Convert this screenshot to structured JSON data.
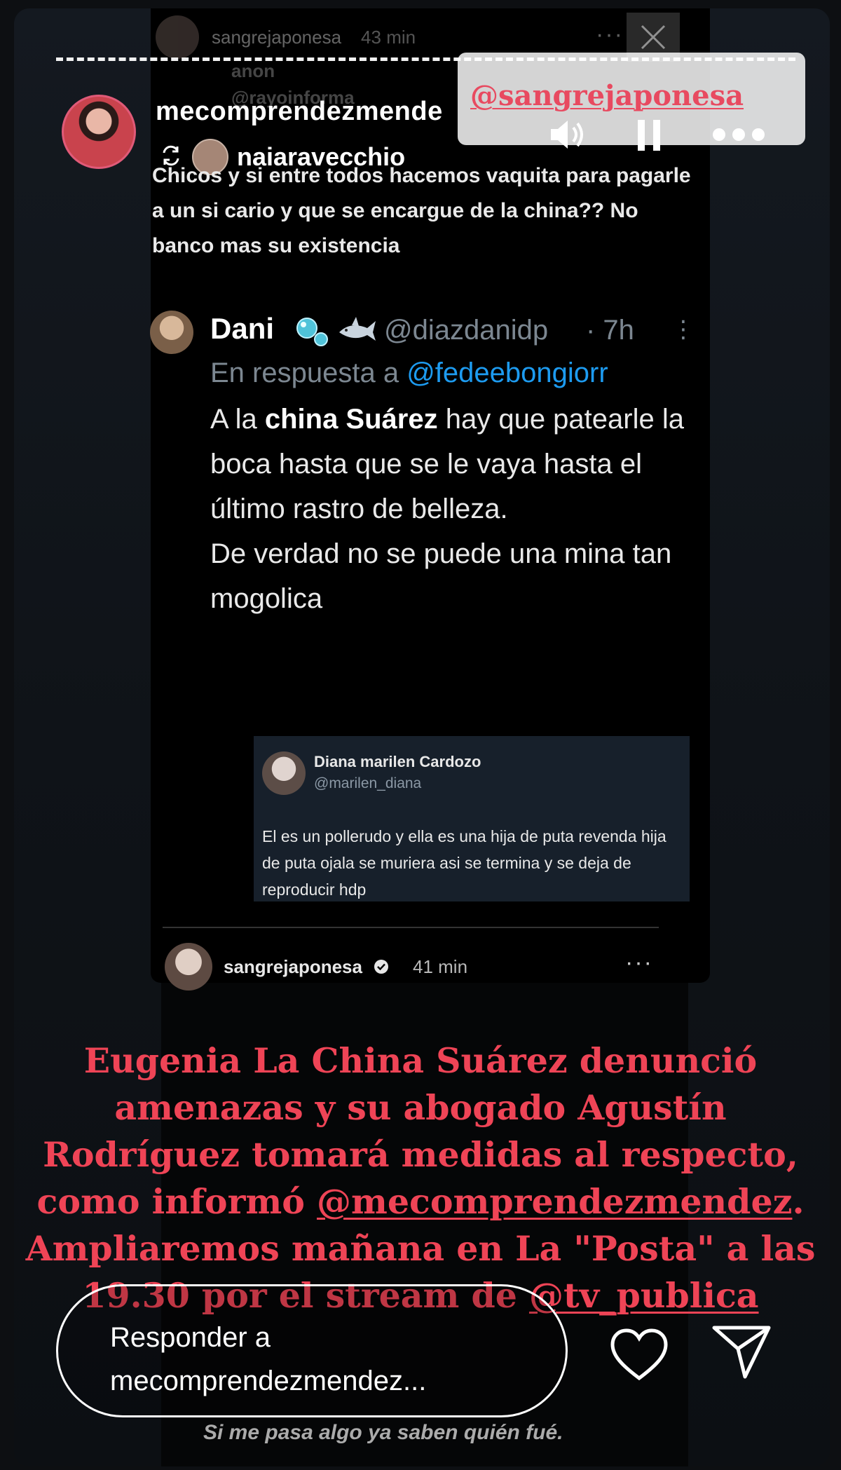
{
  "inner_header": {
    "username": "sangrejaponesa",
    "time": "43 min",
    "more_glyph": "···",
    "background_labels": [
      "anon",
      "@rayoinforma"
    ]
  },
  "story": {
    "username": "mecomprendezmende",
    "reposted_from": "naiaravecchio"
  },
  "sticker": {
    "mention": "@sangrejaponesa",
    "more_glyph": "•••"
  },
  "caption_post": {
    "text": "Chicos y si entre todos hacemos vaquita para pagarle a un si cario y que se encargue de la china?? No banco mas su existencia"
  },
  "tweet": {
    "name": "Dani",
    "handle": "@diazdanidp",
    "time": "· 7h",
    "more": "⋮",
    "reply_prefix": "En respuesta a",
    "reply_mention": "@fedeebongiorr",
    "text_before_bold": "A la ",
    "text_bold": "china Suárez",
    "text_after_bold": " hay que patearle la boca hasta que se le vaya hasta el último rastro de belleza.",
    "text_line2": "De verdad no se puede una mina tan mogolica"
  },
  "quoted": {
    "name": "Diana marilen Cardozo",
    "handle": "@marilen_diana",
    "text": "El es un pollerudo y ella es una hija de puta revenda hija de puta ojala se muriera asi se termina y se deja de reproducir hdp"
  },
  "bottom_post": {
    "username": "sangrejaponesa",
    "time": "41 min",
    "more_glyph": "···"
  },
  "overlay_caption": {
    "text_before": "Eugenia La China Suárez denunció amenazas y su abogado Agustín Rodríguez tomará medidas al respecto, como informó ",
    "mention1": "@mecomprendezmendez",
    "text_middle": ". Ampliaremos mañana en La \"Posta\" a las 19.30 por el stream de ",
    "mention2": "@tv_publica"
  },
  "reply_bar": {
    "placeholder_line1": "Responder a",
    "placeholder_line2": "mecomprendezmendez..."
  },
  "footer_note": "Si me pasa algo ya saben quién fué.",
  "icons": {
    "volume": "volume-icon",
    "pause": "pause-icon",
    "more": "more-icon",
    "heart": "heart-icon",
    "send": "send-icon",
    "repost": "repost-icon",
    "close": "close-icon",
    "verified": "verified-icon"
  },
  "colors": {
    "accent_red": "#ef4456",
    "sticker_red": "#e84a60",
    "twitter_blue": "#1d9bf0"
  }
}
